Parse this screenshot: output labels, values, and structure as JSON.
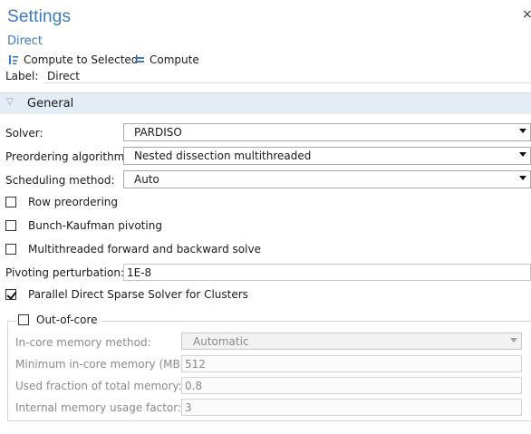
{
  "header": {
    "title": "Settings",
    "subtitle": "Direct",
    "close_glyph": "×"
  },
  "toolbar": {
    "compute_to_selected_label": "Compute to Selected",
    "compute_label": "Compute",
    "compute_to_selected_icon": "compute-to-selected-icon",
    "compute_icon": "compute-icon"
  },
  "label_field": {
    "label": "Label:",
    "value": "Direct"
  },
  "section": {
    "title": "General",
    "chevron": "▽"
  },
  "general": {
    "solver_label": "Solver:",
    "solver_value": "PARDISO",
    "preordering_label": "Preordering algorithm:",
    "preordering_value": "Nested dissection multithreaded",
    "scheduling_label": "Scheduling method:",
    "scheduling_value": "Auto",
    "row_preordering_label": "Row preordering",
    "row_preordering_checked": false,
    "bunch_kaufman_label": "Bunch-Kaufman pivoting",
    "bunch_kaufman_checked": false,
    "multithreaded_label": "Multithreaded forward and backward solve",
    "multithreaded_checked": false,
    "pivoting_label": "Pivoting perturbation:",
    "pivoting_value": "1E-8",
    "parallel_label": "Parallel Direct Sparse Solver for Clusters",
    "parallel_checked": true
  },
  "out_of_core": {
    "label": "Out-of-core",
    "checked": false,
    "in_core_method_label": "In-core memory method:",
    "in_core_method_value": "Automatic",
    "min_memory_label": "Minimum in-core memory (MB):",
    "min_memory_value": "512",
    "used_fraction_label": "Used fraction of total memory:",
    "used_fraction_value": "0.8",
    "usage_factor_label": "Internal memory usage factor:",
    "usage_factor_value": "3"
  },
  "colors": {
    "title": "#3a7abf",
    "section_header_bg": "#e4ecf5",
    "disabled_text": "#8a8a8a"
  }
}
